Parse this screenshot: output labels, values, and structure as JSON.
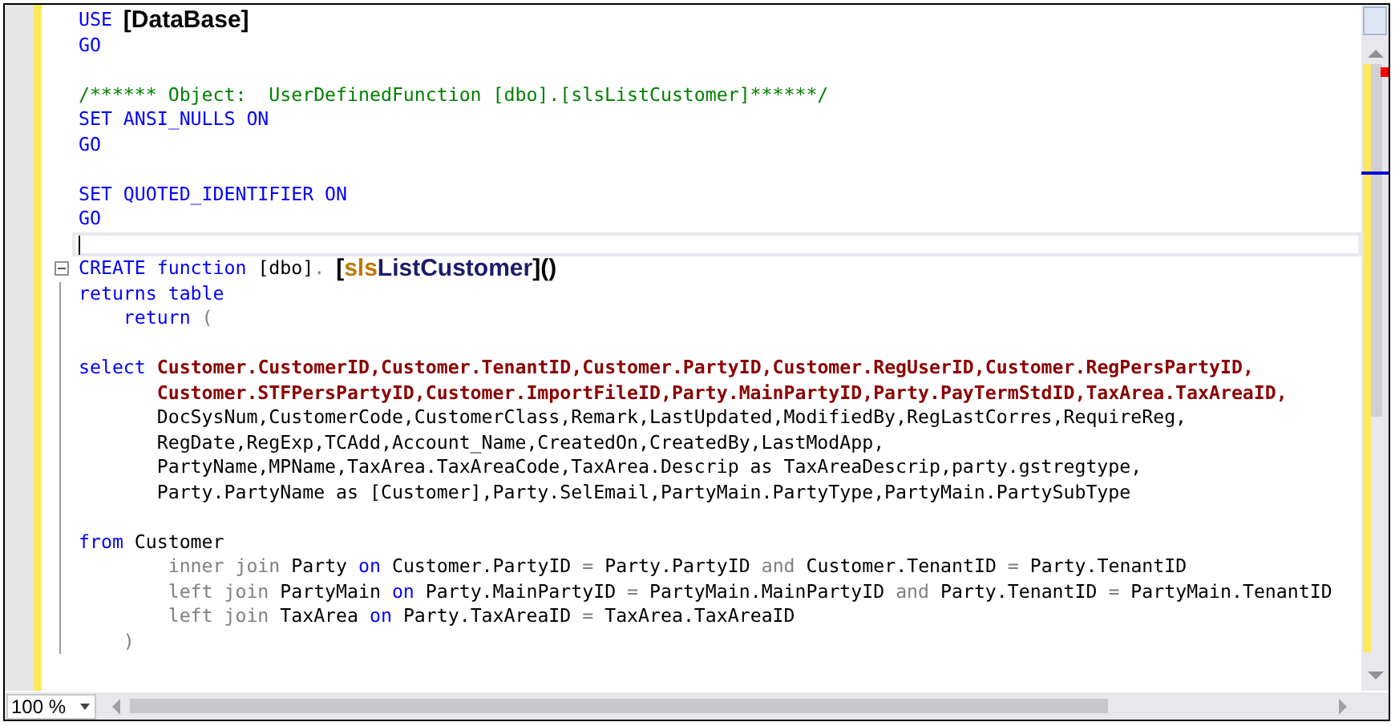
{
  "editor": {
    "lines": [
      {
        "current": false,
        "fold_start": false,
        "tokens": [
          {
            "kind": "keyword",
            "text": "USE "
          },
          {
            "kind": "heading",
            "text": "[DataBase]"
          }
        ]
      },
      {
        "current": false,
        "fold_start": false,
        "tokens": [
          {
            "kind": "keyword",
            "text": "GO"
          }
        ]
      },
      {
        "current": false,
        "fold_start": false
      },
      {
        "current": false,
        "fold_start": false,
        "tokens": [
          {
            "kind": "comment",
            "text": "/****** Object:  UserDefinedFunction [dbo].[slsListCustomer]******/"
          }
        ]
      },
      {
        "current": false,
        "fold_start": false,
        "tokens": [
          {
            "kind": "keyword",
            "text": "SET ANSI_NULLS ON"
          }
        ]
      },
      {
        "current": false,
        "fold_start": false,
        "tokens": [
          {
            "kind": "keyword",
            "text": "GO"
          }
        ]
      },
      {
        "current": false,
        "fold_start": false
      },
      {
        "current": false,
        "fold_start": false,
        "tokens": [
          {
            "kind": "keyword",
            "text": "SET QUOTED_IDENTIFIER ON"
          }
        ]
      },
      {
        "current": false,
        "fold_start": false,
        "tokens": [
          {
            "kind": "keyword",
            "text": "GO"
          }
        ]
      },
      {
        "current": true,
        "fold_start": false
      },
      {
        "current": false,
        "fold_start": true,
        "tokens": [
          {
            "kind": "keyword",
            "text": "CREATE function "
          },
          {
            "kind": "text",
            "text": "[dbo]"
          },
          {
            "kind": "operator",
            "text": ". "
          },
          {
            "kind": "heading",
            "text": "["
          },
          {
            "kind": "prefix",
            "text": "sls"
          },
          {
            "kind": "name",
            "text": "ListCustomer"
          },
          {
            "kind": "heading",
            "text": "]()"
          }
        ]
      },
      {
        "current": false,
        "fold_start": false,
        "tokens": [
          {
            "kind": "keyword",
            "text": "returns table"
          }
        ]
      },
      {
        "current": false,
        "fold_start": false,
        "tokens": [
          {
            "kind": "keyword",
            "text": "    return "
          },
          {
            "kind": "operator",
            "text": "("
          }
        ]
      },
      {
        "current": false,
        "fold_start": false
      },
      {
        "current": false,
        "fold_start": false,
        "tokens": [
          {
            "kind": "keyword",
            "text": "select "
          },
          {
            "kind": "column",
            "text": "Customer.CustomerID,Customer.TenantID,Customer.PartyID,Customer.RegUserID,Customer.RegPersPartyID,"
          }
        ]
      },
      {
        "current": false,
        "fold_start": false,
        "tokens": [
          {
            "kind": "column",
            "text": "       Customer.STFPersPartyID,Customer.ImportFileID,Party.MainPartyID,Party.PayTermStdID,TaxArea.TaxAreaID,"
          }
        ]
      },
      {
        "current": false,
        "fold_start": false,
        "tokens": [
          {
            "kind": "text",
            "text": "       DocSysNum,CustomerCode,CustomerClass,Remark,LastUpdated,ModifiedBy,RegLastCorres,RequireReg,"
          }
        ]
      },
      {
        "current": false,
        "fold_start": false,
        "tokens": [
          {
            "kind": "text",
            "text": "       RegDate,RegExp,TCAdd,Account_Name,CreatedOn,CreatedBy,LastModApp,"
          }
        ]
      },
      {
        "current": false,
        "fold_start": false,
        "tokens": [
          {
            "kind": "text",
            "text": "       PartyName,MPName,TaxArea.TaxAreaCode,TaxArea.Descrip as TaxAreaDescrip,party.gstregtype,"
          }
        ]
      },
      {
        "current": false,
        "fold_start": false,
        "tokens": [
          {
            "kind": "text",
            "text": "       Party.PartyName as [Customer],Party.SelEmail,PartyMain.PartyType,PartyMain.PartySubType"
          }
        ]
      },
      {
        "current": false,
        "fold_start": false
      },
      {
        "current": false,
        "fold_start": false,
        "tokens": [
          {
            "kind": "keyword",
            "text": "from "
          },
          {
            "kind": "text",
            "text": "Customer"
          }
        ]
      },
      {
        "current": false,
        "fold_start": false,
        "tokens": [
          {
            "kind": "operator",
            "text": "        inner join "
          },
          {
            "kind": "text",
            "text": "Party "
          },
          {
            "kind": "keyword",
            "text": "on "
          },
          {
            "kind": "text",
            "text": "Customer.PartyID "
          },
          {
            "kind": "operator",
            "text": "= "
          },
          {
            "kind": "text",
            "text": "Party.PartyID "
          },
          {
            "kind": "operator",
            "text": "and "
          },
          {
            "kind": "text",
            "text": "Customer.TenantID "
          },
          {
            "kind": "operator",
            "text": "= "
          },
          {
            "kind": "text",
            "text": "Party.TenantID"
          }
        ]
      },
      {
        "current": false,
        "fold_start": false,
        "tokens": [
          {
            "kind": "operator",
            "text": "        left join "
          },
          {
            "kind": "text",
            "text": "PartyMain "
          },
          {
            "kind": "keyword",
            "text": "on "
          },
          {
            "kind": "text",
            "text": "Party.MainPartyID "
          },
          {
            "kind": "operator",
            "text": "= "
          },
          {
            "kind": "text",
            "text": "PartyMain.MainPartyID "
          },
          {
            "kind": "operator",
            "text": "and "
          },
          {
            "kind": "text",
            "text": "Party.TenantID "
          },
          {
            "kind": "operator",
            "text": "= "
          },
          {
            "kind": "text",
            "text": "PartyMain.TenantID"
          }
        ]
      },
      {
        "current": false,
        "fold_start": false,
        "tokens": [
          {
            "kind": "operator",
            "text": "        left join "
          },
          {
            "kind": "text",
            "text": "TaxArea "
          },
          {
            "kind": "keyword",
            "text": "on "
          },
          {
            "kind": "text",
            "text": "Party.TaxAreaID "
          },
          {
            "kind": "operator",
            "text": "= "
          },
          {
            "kind": "text",
            "text": "TaxArea.TaxAreaID"
          }
        ]
      },
      {
        "current": false,
        "fold_start": false,
        "tokens": [
          {
            "kind": "operator",
            "text": "    )"
          }
        ]
      }
    ]
  },
  "zoom": {
    "value": "100 %"
  }
}
